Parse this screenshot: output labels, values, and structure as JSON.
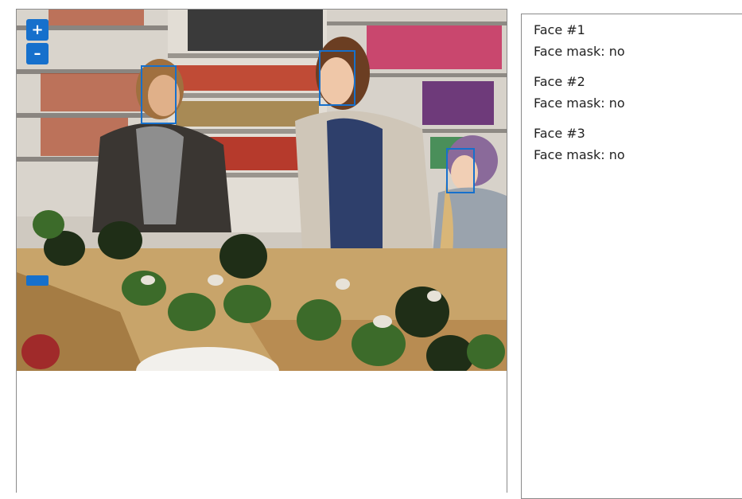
{
  "zoom": {
    "in_label": "+",
    "out_label": "–"
  },
  "faces": [
    {
      "title": "Face #1",
      "mask_label": "Face mask: no"
    },
    {
      "title": "Face #2",
      "mask_label": "Face mask: no"
    },
    {
      "title": "Face #3",
      "mask_label": "Face mask: no"
    }
  ],
  "colors": {
    "accent": "#1670cc",
    "border": "#8a8a8a"
  },
  "icons": {
    "zoom_in": "plus-icon",
    "zoom_out": "minus-icon"
  }
}
